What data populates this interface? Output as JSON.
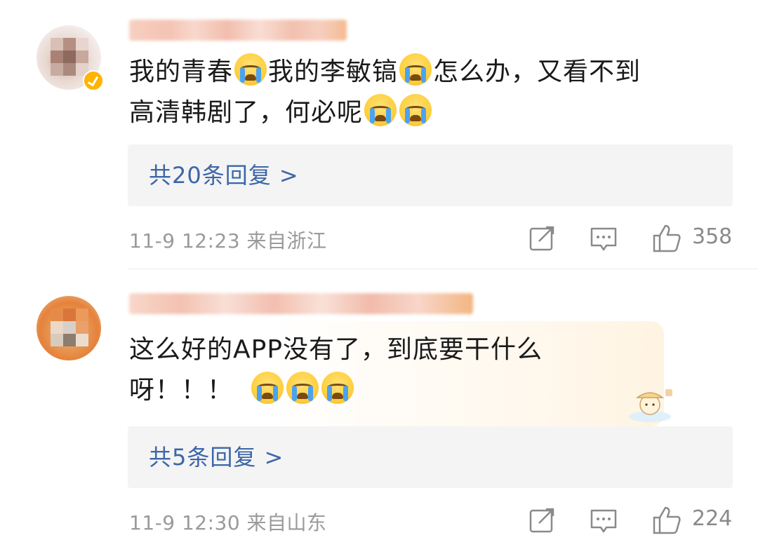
{
  "comments": [
    {
      "text_line1": "我的青春",
      "text_line1b": "我的李敏镐",
      "text_line1c": "怎么办，又看不到",
      "text_line2": "高清韩剧了，何必呢",
      "replies_label": "共20条回复 >",
      "meta": "11-9 12:23 来自浙江",
      "likes": "358",
      "icons": [
        "share-icon",
        "comment-icon",
        "thumbs-up-icon"
      ]
    },
    {
      "text_line1": "这么好的APP没有了，到底要干什么",
      "text_line2": "呀！！！",
      "replies_label": "共5条回复 >",
      "meta": "11-9 12:30 来自山东",
      "likes": "224",
      "icons": [
        "share-icon",
        "comment-icon",
        "thumbs-up-icon"
      ]
    }
  ],
  "colors": {
    "link_blue": "#3b66a8",
    "meta_gray": "#9a9a9a",
    "reply_box_bg": "#f4f4f4"
  }
}
